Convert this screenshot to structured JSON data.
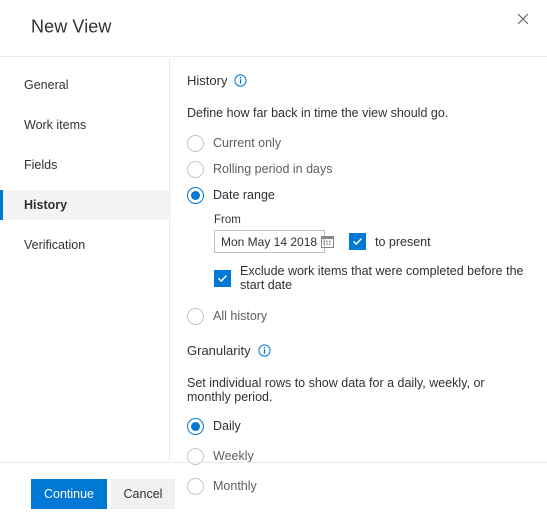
{
  "dialog": {
    "title": "New View",
    "close_icon": "close-icon"
  },
  "sidebar": {
    "items": [
      {
        "label": "General",
        "selected": false
      },
      {
        "label": "Work items",
        "selected": false
      },
      {
        "label": "Fields",
        "selected": false
      },
      {
        "label": "History",
        "selected": true
      },
      {
        "label": "Verification",
        "selected": false
      }
    ]
  },
  "history": {
    "heading": "History",
    "info_icon": "info-icon",
    "description": "Define how far back in time the view should go.",
    "options": [
      {
        "label": "Current only",
        "selected": false
      },
      {
        "label": "Rolling period in days",
        "selected": false
      },
      {
        "label": "Date range",
        "selected": true
      },
      {
        "label": "All history",
        "selected": false
      }
    ],
    "date_range": {
      "from_label": "From",
      "from_value": "Mon May 14 2018",
      "calendar_icon": "calendar-icon",
      "to_present_label": "to present",
      "to_present_checked": true,
      "exclude_label": "Exclude work items that were completed before the start date",
      "exclude_checked": true
    }
  },
  "granularity": {
    "heading": "Granularity",
    "info_icon": "info-icon",
    "description": "Set individual rows to show data for a daily, weekly, or monthly period.",
    "options": [
      {
        "label": "Daily",
        "selected": true
      },
      {
        "label": "Weekly",
        "selected": false
      },
      {
        "label": "Monthly",
        "selected": false
      }
    ]
  },
  "footer": {
    "continue_label": "Continue",
    "cancel_label": "Cancel"
  },
  "colors": {
    "accent": "#0078d4",
    "selected_nav_bg": "#f4f4f4",
    "secondary_button_bg": "#f0f0f0",
    "divider": "#eaeaea"
  }
}
